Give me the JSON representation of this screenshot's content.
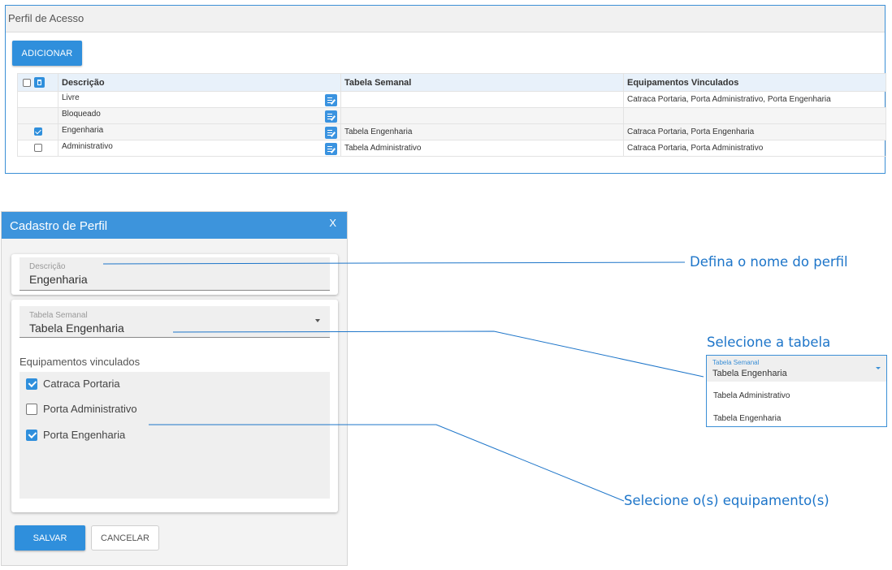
{
  "panel": {
    "title": "Perfil de Acesso",
    "add_button": "ADICIONAR",
    "columns": [
      "Descrição",
      "Tabela Semanal",
      "Equipamentos Vinculados"
    ],
    "rows": [
      {
        "checked": false,
        "show_checkbox": false,
        "descricao": "Livre",
        "tabela": "",
        "equipamentos": "Catraca Portaria, Porta Administrativo, Porta Engenharia"
      },
      {
        "checked": false,
        "show_checkbox": false,
        "descricao": "Bloqueado",
        "tabela": "",
        "equipamentos": ""
      },
      {
        "checked": true,
        "show_checkbox": true,
        "descricao": "Engenharia",
        "tabela": "Tabela Engenharia",
        "equipamentos": "Catraca Portaria, Porta Engenharia"
      },
      {
        "checked": false,
        "show_checkbox": true,
        "descricao": "Administrativo",
        "tabela": "Tabela Administrativo",
        "equipamentos": "Catraca Portaria, Porta Administrativo"
      }
    ]
  },
  "dialog": {
    "title": "Cadastro de Perfil",
    "close": "X",
    "descricao_label": "Descrição",
    "descricao_value": "Engenharia",
    "tabela_label": "Tabela Semanal",
    "tabela_value": "Tabela Engenharia",
    "equipamentos_label": "Equipamentos vinculados",
    "equipamentos": [
      {
        "label": "Catraca Portaria",
        "checked": true
      },
      {
        "label": "Porta Administrativo",
        "checked": false
      },
      {
        "label": "Porta Engenharia",
        "checked": true
      }
    ],
    "save": "SALVAR",
    "cancel": "CANCELAR"
  },
  "annotations": {
    "nome": "Defina o nome do perfil",
    "tabela": "Selecione a tabela",
    "equipamentos": "Selecione o(s) equipamento(s)",
    "line_color": "#1d75c9"
  },
  "dropdown": {
    "label": "Tabela Semanal",
    "value": "Tabela Engenharia",
    "options": [
      "Tabela Administrativo",
      "Tabela Engenharia"
    ]
  },
  "colors": {
    "accent": "#2f8fdc",
    "dialog_header": "#3d94dc",
    "annotation": "#1d75c9"
  }
}
